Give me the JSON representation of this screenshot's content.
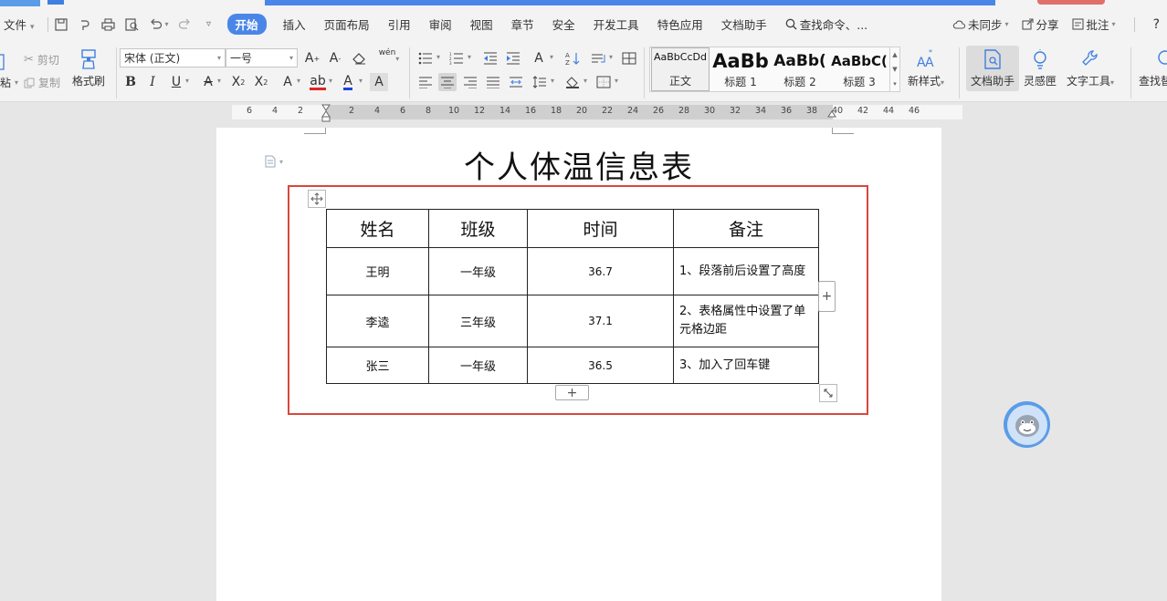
{
  "menu": {
    "file": "文件",
    "tabs": [
      "开始",
      "插入",
      "页面布局",
      "引用",
      "审阅",
      "视图",
      "章节",
      "安全",
      "开发工具",
      "特色应用",
      "文档助手"
    ],
    "active_tab": "开始",
    "search": "查找命令、...",
    "sync": "未同步",
    "share": "分享",
    "comment": "批注",
    "help": "?"
  },
  "ribbon": {
    "cut": "剪切",
    "copy": "复制",
    "paste_fragment": "粘",
    "format_painter": "格式刷",
    "font_name": "宋体 (正文)",
    "font_size": "一号",
    "pinyin_glyph": "wén",
    "styles": [
      {
        "sample": "AaBbCcDd",
        "name": "正文"
      },
      {
        "sample": "AaBb",
        "name": "标题 1"
      },
      {
        "sample": "AaBb(",
        "name": "标题 2"
      },
      {
        "sample": "AaBbC(",
        "name": "标题 3"
      }
    ],
    "new_style": "新样式",
    "doc_assistant": "文档助手",
    "inspiration": "灵感匣",
    "text_tools": "文字工具",
    "find_replace": "查找替"
  },
  "ruler": {
    "left_ticks": [
      "6",
      "4",
      "2"
    ],
    "right_ticks": [
      "2",
      "4",
      "6",
      "8",
      "10",
      "12",
      "14",
      "16",
      "18",
      "20",
      "22",
      "24",
      "26",
      "28",
      "30",
      "32",
      "34",
      "36",
      "38",
      "40",
      "42",
      "44",
      "46"
    ]
  },
  "document": {
    "title": "个人体温信息表",
    "table": {
      "headers": [
        "姓名",
        "班级",
        "时间",
        "备注"
      ],
      "rows": [
        [
          "王明",
          "一年级",
          "36.7",
          "1、段落前后设置了高度"
        ],
        [
          "李逵",
          "三年级",
          "37.1",
          "2、表格属性中设置了单元格边距"
        ],
        [
          "张三",
          "一年级",
          "36.5",
          "3、加入了回车键"
        ]
      ]
    },
    "add_col_label": "+",
    "add_row_label": "+"
  },
  "colors": {
    "accent": "#4a86e8",
    "highlight_border": "#d8473d"
  }
}
